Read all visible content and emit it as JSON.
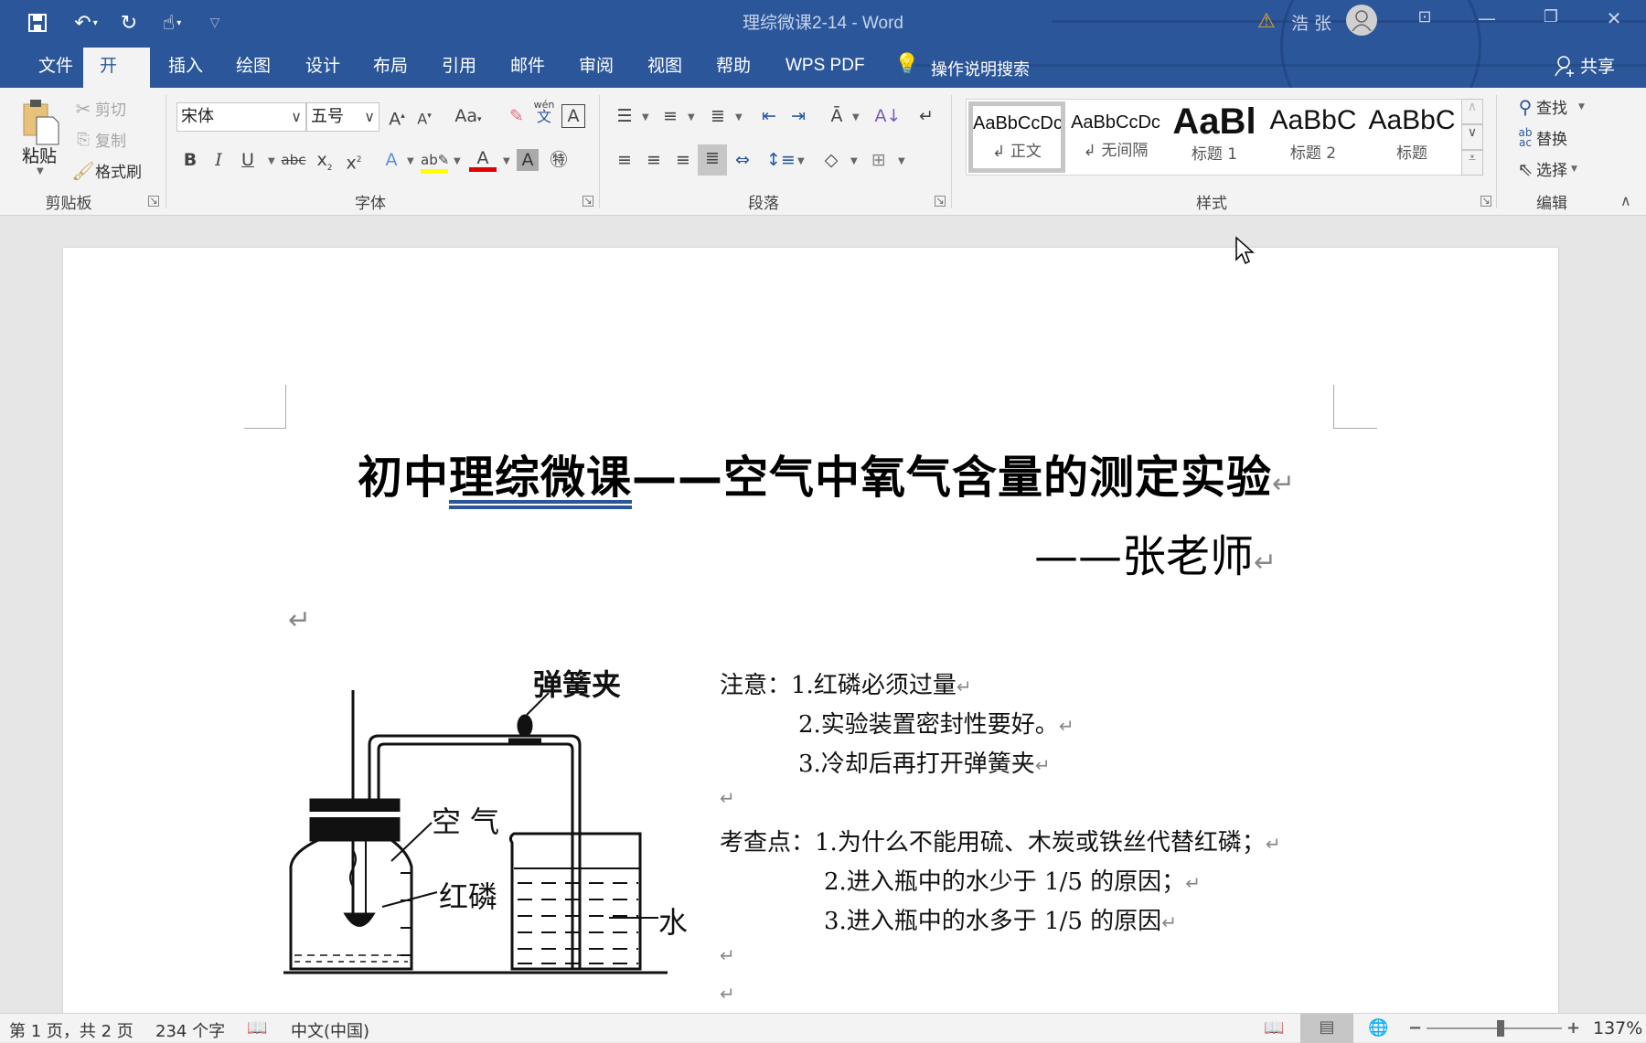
{
  "window": {
    "title": "理综微课2-14  -  Word",
    "user_name": "浩 张",
    "warning_icon": "warning-icon",
    "controls": [
      "ribbon-display-options",
      "minimize",
      "restore",
      "close"
    ]
  },
  "quick_access": {
    "items": [
      "save-icon",
      "undo-icon",
      "redo-icon",
      "touch-mode-icon",
      "customize-icon"
    ]
  },
  "tabs": [
    {
      "label": "文件"
    },
    {
      "label": "开始",
      "active": true
    },
    {
      "label": "插入"
    },
    {
      "label": "绘图"
    },
    {
      "label": "设计"
    },
    {
      "label": "布局"
    },
    {
      "label": "引用"
    },
    {
      "label": "邮件"
    },
    {
      "label": "审阅"
    },
    {
      "label": "视图"
    },
    {
      "label": "帮助"
    },
    {
      "label": "WPS PDF"
    }
  ],
  "tell_me": "操作说明搜索",
  "share": "共享",
  "ribbon": {
    "clipboard": {
      "label": "剪贴板",
      "paste": "粘贴",
      "cut": "剪切",
      "copy": "复制",
      "format_painter": "格式刷"
    },
    "font": {
      "label": "字体",
      "font_name": "宋体",
      "font_size": "五号",
      "change_case": "Aa",
      "phonetic_top": "wén",
      "phonetic_bottom": "文"
    },
    "paragraph": {
      "label": "段落"
    },
    "styles": {
      "label": "样式",
      "items": [
        {
          "sample": "AaBbCcDc",
          "name": "↲ 正文",
          "selected": true
        },
        {
          "sample": "AaBbCcDc",
          "name": "↲ 无间隔"
        },
        {
          "sample": "AaBl",
          "name": "标题 1"
        },
        {
          "sample": "AaBbC",
          "name": "标题 2"
        },
        {
          "sample": "AaBbC",
          "name": "标题"
        }
      ]
    },
    "editing": {
      "label": "编辑",
      "find": "查找",
      "replace": "替换",
      "select": "选择"
    }
  },
  "document": {
    "heading_part1": "初中",
    "heading_underlined": "理综微课",
    "heading_part2": "——空气中氧气含量的测定实验",
    "author": "——张老师",
    "paragraph_mark": "↵",
    "notes_label": "注意：",
    "notes": [
      "1.红磷必须过量",
      "2.实验装置密封性要好。",
      "3.冷却后再打开弹簧夹"
    ],
    "exam_label": "考查点：",
    "exam_points": [
      "1.为什么不能用硫、木炭或铁丝代替红磷；",
      "2.进入瓶中的水少于 1/5 的原因；",
      "3.进入瓶中的水多于 1/5 的原因"
    ],
    "diagram_labels": {
      "clamp": "弹簧夹",
      "air": "空气",
      "phosphorus": "红磷",
      "water": "水"
    }
  },
  "statusbar": {
    "page": "第 1 页，共 2 页",
    "words": "234 个字",
    "language": "中文(中国)",
    "zoom": "137%",
    "zoom_percent": 137
  }
}
